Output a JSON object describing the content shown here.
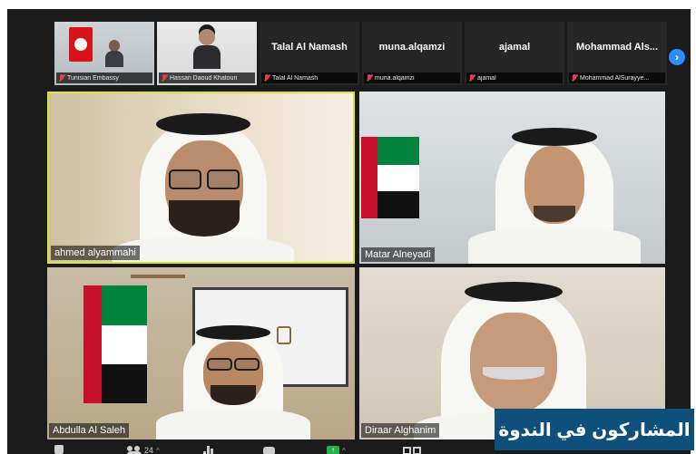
{
  "participants_strip": [
    {
      "display": "",
      "name": "Tunisian Embassy",
      "muted": true
    },
    {
      "display": "",
      "name": "Hassan Daoud Khatoun",
      "muted": true
    },
    {
      "display": "Talal Al Namash",
      "name": "Talal Al Namash",
      "muted": true
    },
    {
      "display": "muna.alqamzi",
      "name": "muna.alqamzi",
      "muted": true
    },
    {
      "display": "ajamal",
      "name": "ajamal",
      "muted": true
    },
    {
      "display": "Mohammad Als...",
      "name": "Mohammad AlSurayye...",
      "muted": true
    }
  ],
  "strip_next_icon": "chevron-right-icon",
  "tiles": [
    {
      "name": "ahmed alyammahi"
    },
    {
      "name": "Matar Alneyadi"
    },
    {
      "name": "Abdulla Al Saleh"
    },
    {
      "name": "Diraar Alghanim"
    }
  ],
  "toolbar": {
    "participants_count": "24"
  },
  "caption": "المشاركون في الندوة",
  "colors": {
    "active_speaker_border": "#d8e33b",
    "caption_bg": "#0f4f7c",
    "muted_mic": "#e04141",
    "nav_button": "#2d8cff",
    "share_button": "#26b24b"
  }
}
